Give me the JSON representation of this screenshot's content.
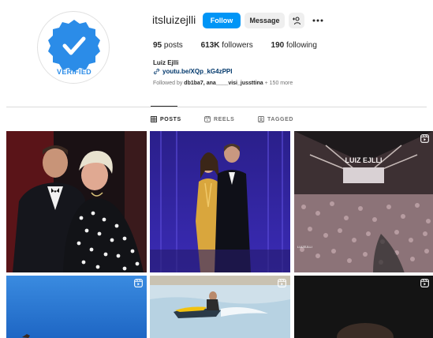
{
  "profile": {
    "username": "itsluizejlli",
    "full_name": "Luiz Ejlli",
    "link": "youtu.be/XQp_kG4zPPI",
    "avatar_text": "VERIFIED",
    "stats": {
      "posts_count": "95",
      "posts_label": "posts",
      "followers_count": "613K",
      "followers_label": "followers",
      "following_count": "190",
      "following_label": "following"
    },
    "followed_prefix": "Followed by ",
    "followed_names": "db1ba7, ana____visi_jussttina",
    "followed_suffix": " + 150 more"
  },
  "actions": {
    "follow": "Follow",
    "message": "Message"
  },
  "tabs": [
    {
      "label": "POSTS",
      "icon": "grid-icon"
    },
    {
      "label": "REELS",
      "icon": "reels-icon"
    },
    {
      "label": "TAGGED",
      "icon": "tagged-icon"
    }
  ],
  "posts": {
    "concert_banner_text": "LUIZ EJLLI",
    "concert_screen_text": "LUIZEJLLI"
  },
  "colors": {
    "accent": "#0095f6",
    "badge_blue": "#2b8ce8",
    "link": "#00376b"
  }
}
